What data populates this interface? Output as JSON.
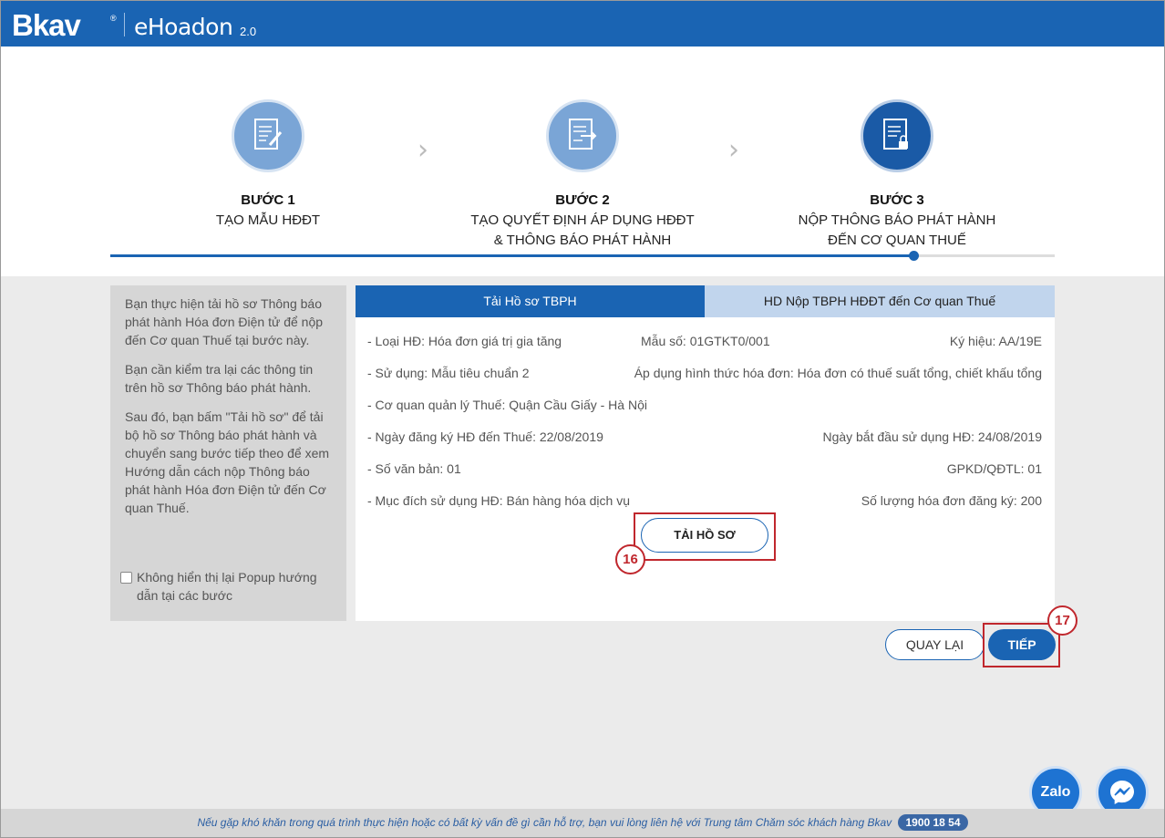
{
  "header": {
    "logo": "Bkav",
    "logo_reg": "®",
    "app_name": "eHoadon",
    "app_version": "2.0"
  },
  "steps": [
    {
      "title": "BƯỚC 1",
      "desc": "TẠO MẪU HĐĐT",
      "icon": "document-pen-icon",
      "active": false
    },
    {
      "title": "BƯỚC 2",
      "desc": "TẠO QUYẾT ĐỊNH ÁP DỤNG HĐĐT\n& THÔNG BÁO PHÁT HÀNH",
      "icon": "document-arrow-icon",
      "active": false
    },
    {
      "title": "BƯỚC 3",
      "desc": "NỘP THÔNG BÁO PHÁT HÀNH\nĐẾN CƠ QUAN THUẾ",
      "icon": "document-lock-icon",
      "active": true
    }
  ],
  "progress": {
    "current_step": 3,
    "total_steps": 3,
    "fraction": 0.85
  },
  "sidebar": {
    "paragraphs": [
      "Bạn thực hiện tải hồ sơ Thông báo phát hành Hóa đơn Điện tử để nộp đến Cơ quan Thuế tại bước này.",
      "Bạn cần kiểm tra lại các thông tin trên hồ sơ Thông báo phát hành.",
      "Sau đó, bạn bấm \"Tải hồ sơ\" để tải bộ hồ sơ Thông báo phát hành và chuyển sang bước tiếp theo để xem Hướng dẫn cách nộp Thông báo phát hành Hóa đơn Điện tử đến Cơ quan Thuế."
    ],
    "checkbox_label": "Không hiển thị lại Popup hướng dẫn tại các bước",
    "checkbox_checked": false
  },
  "tabs": [
    {
      "label": "Tải Hồ sơ TBPH",
      "active": true
    },
    {
      "label": "HD Nộp TBPH HĐĐT đến Cơ quan Thuế",
      "active": false
    }
  ],
  "info": {
    "loai_hd": "- Loại HĐ: Hóa đơn giá trị gia tăng",
    "mau_so": "Mẫu số: 01GTKT0/001",
    "ky_hieu": "Ký hiệu: AA/19E",
    "su_dung": "- Sử dụng: Mẫu tiêu chuẩn 2",
    "ap_dung": "Áp dụng hình thức hóa đơn: Hóa đơn có thuế suất tổng, chiết khấu tổng",
    "co_quan": "- Cơ quan quản lý Thuế: Quận Cầu Giấy - Hà Nội",
    "ngay_dang_ky": "- Ngày đăng ký HĐ đến Thuế: 22/08/2019",
    "ngay_bat_dau": "Ngày bắt đầu sử dụng HĐ: 24/08/2019",
    "so_van_ban": "- Số văn bản: 01",
    "gpkd": "GPKD/QĐTL: 01",
    "muc_dich": "- Mục đích sử dụng HĐ: Bán hàng hóa dịch vụ",
    "so_luong": "Số lượng hóa đơn đăng ký: 200"
  },
  "buttons": {
    "tai_ho_so": "TẢI HỒ SƠ",
    "quay_lai": "QUAY LẠI",
    "tiep": "TIẾP"
  },
  "annotations": {
    "a16": "16",
    "a17": "17"
  },
  "chat": {
    "zalo": "Zalo",
    "messenger_icon": "messenger-icon"
  },
  "footer": {
    "text": "Nếu gặp khó khăn trong quá trình thực hiện hoặc có bất kỳ vấn đề gì cần hỗ trợ, bạn vui lòng liên hệ với Trung tâm Chăm sóc khách hàng Bkav",
    "hotline": "1900 18 54"
  },
  "colors": {
    "primary": "#1a64b3",
    "annotation": "#c0272d",
    "tab_inactive": "#c1d5ed"
  }
}
